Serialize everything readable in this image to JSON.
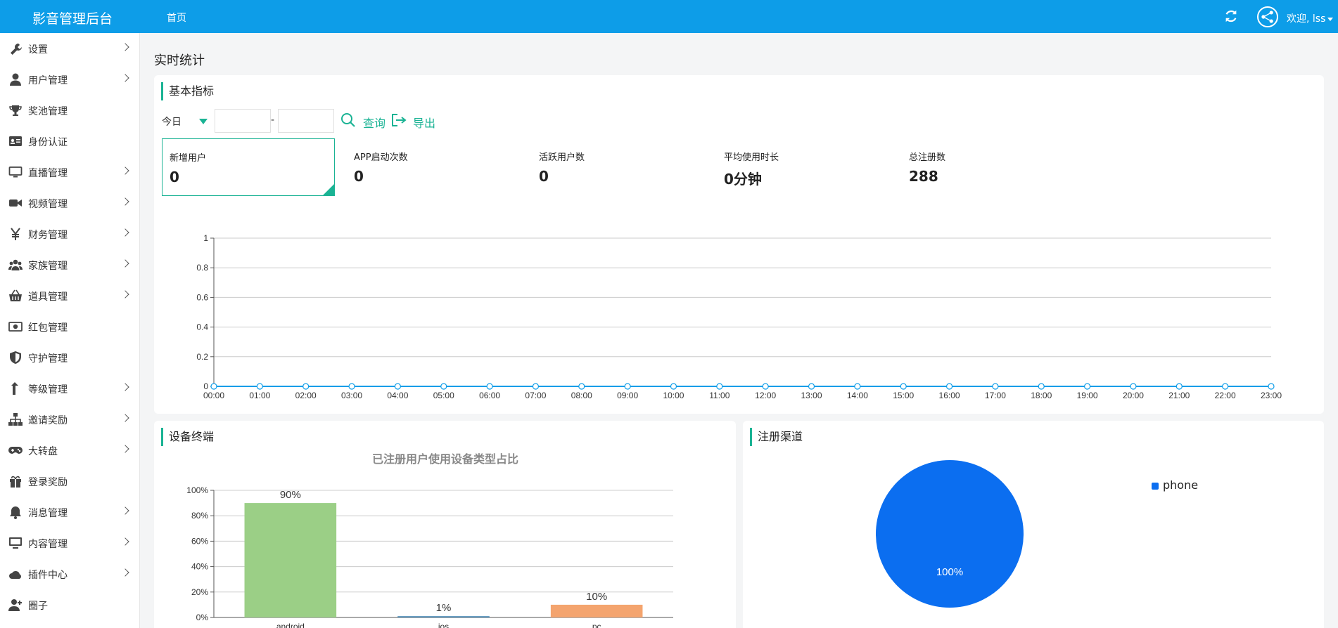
{
  "header": {
    "brand": "影音管理后台",
    "nav_home": "首页",
    "user_greeting": "欢迎, lss",
    "bg_color": "#0d9de8"
  },
  "sidebar": {
    "items": [
      {
        "label": "设置",
        "icon": "wrench-icon",
        "has_children": true
      },
      {
        "label": "用户管理",
        "icon": "user-icon",
        "has_children": true
      },
      {
        "label": "奖池管理",
        "icon": "trophy-icon",
        "has_children": false
      },
      {
        "label": "身份认证",
        "icon": "id-card-icon",
        "has_children": false
      },
      {
        "label": "直播管理",
        "icon": "monitor-icon",
        "has_children": true
      },
      {
        "label": "视频管理",
        "icon": "video-camera-icon",
        "has_children": true
      },
      {
        "label": "财务管理",
        "icon": "yen-icon",
        "has_children": true
      },
      {
        "label": "家族管理",
        "icon": "users-icon",
        "has_children": true
      },
      {
        "label": "道具管理",
        "icon": "basket-icon",
        "has_children": true
      },
      {
        "label": "红包管理",
        "icon": "money-icon",
        "has_children": false
      },
      {
        "label": "守护管理",
        "icon": "shield-icon",
        "has_children": false
      },
      {
        "label": "等级管理",
        "icon": "level-up-icon",
        "has_children": true
      },
      {
        "label": "邀请奖励",
        "icon": "sitemap-icon",
        "has_children": true
      },
      {
        "label": "大转盘",
        "icon": "gamepad-icon",
        "has_children": true
      },
      {
        "label": "登录奖励",
        "icon": "gift-icon",
        "has_children": false
      },
      {
        "label": "消息管理",
        "icon": "bell-icon",
        "has_children": true
      },
      {
        "label": "内容管理",
        "icon": "desktop-icon",
        "has_children": true
      },
      {
        "label": "插件中心",
        "icon": "cloud-icon",
        "has_children": true
      },
      {
        "label": "圈子",
        "icon": "user-plus-icon",
        "has_children": false
      }
    ]
  },
  "main": {
    "page_title": "实时统计",
    "basic": {
      "heading": "基本指标",
      "filter_period": "今日",
      "date_separator": "-",
      "query_label": "查询",
      "export_label": "导出",
      "stats": [
        {
          "label": "新增用户",
          "value": "0",
          "active": true
        },
        {
          "label": "APP启动次数",
          "value": "0",
          "active": false
        },
        {
          "label": "活跃用户数",
          "value": "0",
          "active": false
        },
        {
          "label": "平均使用时长",
          "value": "0分钟",
          "active": false
        },
        {
          "label": "总注册数",
          "value": "288",
          "active": false
        }
      ]
    },
    "devices": {
      "heading": "设备终端",
      "chart_title": "已注册用户使用设备类型占比"
    },
    "channels": {
      "heading": "注册渠道"
    }
  },
  "chart_data": [
    {
      "type": "line",
      "x": [
        "00:00",
        "01:00",
        "02:00",
        "03:00",
        "04:00",
        "05:00",
        "06:00",
        "07:00",
        "08:00",
        "09:00",
        "10:00",
        "11:00",
        "12:00",
        "13:00",
        "14:00",
        "15:00",
        "16:00",
        "17:00",
        "18:00",
        "19:00",
        "20:00",
        "21:00",
        "22:00",
        "23:00"
      ],
      "series": [
        {
          "values": [
            0,
            0,
            0,
            0,
            0,
            0,
            0,
            0,
            0,
            0,
            0,
            0,
            0,
            0,
            0,
            0,
            0,
            0,
            0,
            0,
            0,
            0,
            0,
            0
          ],
          "color": "#0d9de8"
        }
      ],
      "y_ticks": [
        "0",
        "0.2",
        "0.4",
        "0.6",
        "0.8",
        "1"
      ],
      "ylim": [
        0,
        1
      ],
      "grid": true
    },
    {
      "type": "bar",
      "title": "已注册用户使用设备类型占比",
      "categories": [
        "android",
        "ios",
        "pc"
      ],
      "values": [
        90,
        1,
        10
      ],
      "data_labels": [
        "90%",
        "1%",
        "10%"
      ],
      "colors": [
        "#9bcf86",
        "#4a8ab5",
        "#f4a46e"
      ],
      "y_ticks": [
        "0%",
        "20%",
        "40%",
        "60%",
        "80%",
        "100%"
      ],
      "ylim": [
        0,
        100
      ],
      "grid": true
    },
    {
      "type": "pie",
      "slices": [
        {
          "name": "phone",
          "value": 100,
          "label": "100%",
          "color": "#0b6ef0"
        }
      ],
      "legend": "top-right"
    }
  ]
}
